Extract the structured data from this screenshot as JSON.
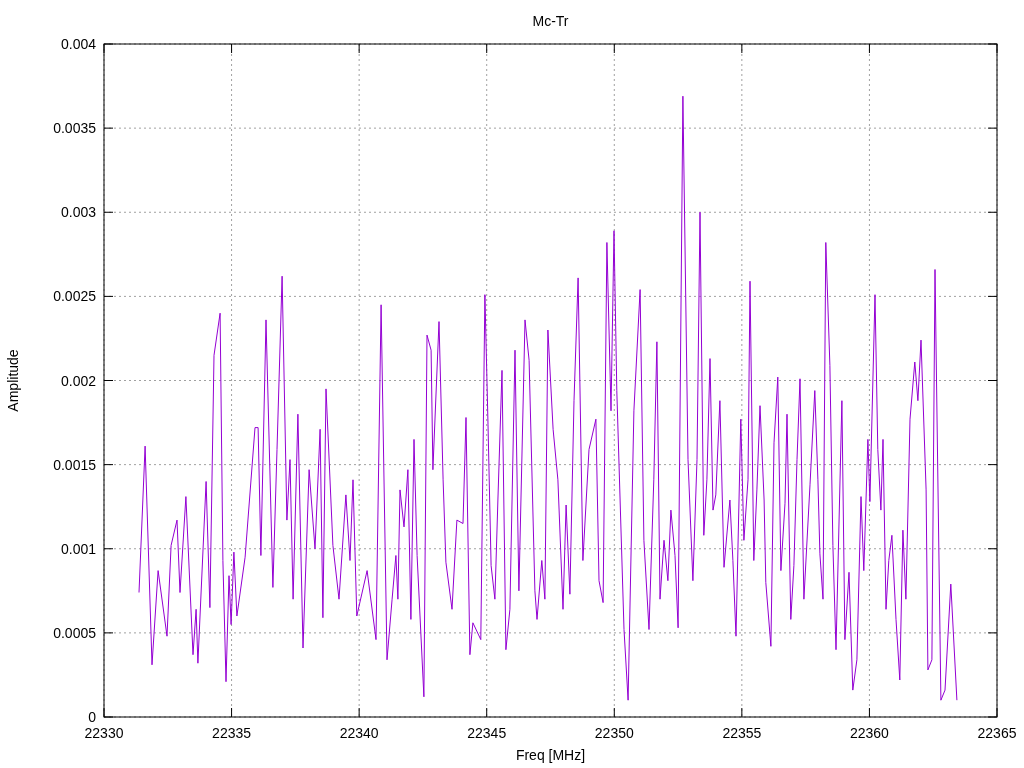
{
  "chart_data": {
    "type": "line",
    "title": "Mc-Tr",
    "xlabel": "Freq [MHz]",
    "ylabel": "Amplitude",
    "xlim": [
      22330,
      22365
    ],
    "ylim": [
      0,
      0.004
    ],
    "xticks": [
      22330,
      22335,
      22340,
      22345,
      22350,
      22355,
      22360,
      22365
    ],
    "yticks": [
      0,
      0.0005,
      0.001,
      0.0015,
      0.002,
      0.0025,
      0.003,
      0.0035,
      0.004
    ],
    "x": [
      22331.37,
      22331.61,
      22331.88,
      22332.12,
      22332.47,
      22332.63,
      22332.86,
      22332.98,
      22333.21,
      22333.49,
      22333.61,
      22333.68,
      22334.0,
      22334.15,
      22334.31,
      22334.55,
      22334.66,
      22334.78,
      22334.9,
      22334.98,
      22335.09,
      22335.21,
      22335.53,
      22335.92,
      22336.04,
      22336.15,
      22336.35,
      22336.62,
      22336.78,
      22336.98,
      22337.17,
      22337.29,
      22337.41,
      22337.6,
      22337.8,
      22338.04,
      22338.27,
      22338.47,
      22338.58,
      22338.7,
      22338.97,
      22339.21,
      22339.48,
      22339.64,
      22339.76,
      22339.91,
      22340.31,
      22340.66,
      22340.86,
      22341.09,
      22341.29,
      22341.44,
      22341.52,
      22341.6,
      22341.76,
      22341.91,
      22342.03,
      22342.15,
      22342.27,
      22342.54,
      22342.66,
      22342.82,
      22342.89,
      22343.13,
      22343.29,
      22343.4,
      22343.64,
      22343.83,
      22344.07,
      22344.19,
      22344.34,
      22344.46,
      22344.77,
      22344.93,
      22345.05,
      22345.17,
      22345.32,
      22345.44,
      22345.6,
      22345.75,
      22345.91,
      22346.11,
      22346.26,
      22346.5,
      22346.66,
      22346.89,
      22346.97,
      22347.16,
      22347.28,
      22347.4,
      22347.6,
      22347.79,
      22347.99,
      22348.11,
      22348.26,
      22348.42,
      22348.58,
      22348.77,
      22349.01,
      22349.28,
      22349.4,
      22349.56,
      22349.71,
      22349.87,
      22349.99,
      22350.1,
      22350.38,
      22350.54,
      22350.77,
      22351.01,
      22351.16,
      22351.36,
      22351.55,
      22351.67,
      22351.79,
      22351.95,
      22352.1,
      22352.22,
      22352.38,
      22352.5,
      22352.69,
      22352.89,
      22353.08,
      22353.24,
      22353.36,
      22353.51,
      22353.63,
      22353.75,
      22353.87,
      22353.98,
      22354.14,
      22354.3,
      22354.53,
      22354.65,
      22354.77,
      22354.96,
      22355.08,
      22355.24,
      22355.32,
      22355.47,
      22355.59,
      22355.71,
      22355.87,
      22355.94,
      22356.14,
      22356.26,
      22356.41,
      22356.53,
      22356.69,
      22356.77,
      22356.92,
      22357.04,
      22357.16,
      22357.28,
      22357.43,
      22357.67,
      22357.86,
      22357.98,
      22358.06,
      22358.18,
      22358.29,
      22358.45,
      22358.57,
      22358.69,
      22358.92,
      22359.04,
      22359.2,
      22359.35,
      22359.51,
      22359.67,
      22359.78,
      22359.94,
      22360.02,
      22360.22,
      22360.33,
      22360.45,
      22360.53,
      22360.65,
      22360.76,
      22360.88,
      22361.04,
      22361.19,
      22361.31,
      22361.43,
      22361.59,
      22361.78,
      22361.9,
      22362.02,
      22362.22,
      22362.29,
      22362.45,
      22362.57,
      22362.8,
      22362.96,
      22363.19,
      22363.43
    ],
    "grid": true,
    "series": [
      {
        "color": "#9400d3",
        "values": [
          0.00074,
          0.00161,
          0.00031,
          0.00087,
          0.00048,
          0.00102,
          0.00117,
          0.00074,
          0.00131,
          0.00037,
          0.00064,
          0.00032,
          0.0014,
          0.00065,
          0.00215,
          0.0024,
          0.00093,
          0.00021,
          0.00084,
          0.00055,
          0.00098,
          0.0006,
          0.00095,
          0.00172,
          0.00172,
          0.00096,
          0.00236,
          0.00077,
          0.00159,
          0.00262,
          0.00117,
          0.00153,
          0.0007,
          0.0018,
          0.00041,
          0.00147,
          0.001,
          0.00171,
          0.00059,
          0.00195,
          0.00102,
          0.0007,
          0.00132,
          0.00093,
          0.00141,
          0.0006,
          0.00087,
          0.00046,
          0.00245,
          0.00034,
          0.0007,
          0.00096,
          0.0007,
          0.00135,
          0.00113,
          0.00147,
          0.00058,
          0.00165,
          0.00096,
          0.00012,
          0.00227,
          0.00218,
          0.00147,
          0.00235,
          0.00141,
          0.00092,
          0.00064,
          0.00117,
          0.00115,
          0.00178,
          0.00037,
          0.00056,
          0.00046,
          0.00251,
          0.00174,
          0.0009,
          0.0007,
          0.00129,
          0.00206,
          0.0004,
          0.00064,
          0.00218,
          0.00075,
          0.00236,
          0.00212,
          0.00075,
          0.00058,
          0.00093,
          0.0007,
          0.0023,
          0.00171,
          0.00141,
          0.00064,
          0.00126,
          0.00073,
          0.00188,
          0.00261,
          0.00093,
          0.00159,
          0.00177,
          0.00081,
          0.00068,
          0.00282,
          0.00182,
          0.00289,
          0.00194,
          0.00052,
          0.0001,
          0.00182,
          0.00254,
          0.00105,
          0.00052,
          0.00141,
          0.00223,
          0.0007,
          0.00105,
          0.00081,
          0.00123,
          0.00096,
          0.00053,
          0.00369,
          0.00153,
          0.00081,
          0.00153,
          0.003,
          0.00108,
          0.00141,
          0.00213,
          0.00123,
          0.00132,
          0.00188,
          0.00089,
          0.00129,
          0.00093,
          0.00048,
          0.00177,
          0.00105,
          0.00141,
          0.00259,
          0.00093,
          0.00135,
          0.00185,
          0.00129,
          0.0008,
          0.00042,
          0.00163,
          0.00202,
          0.00087,
          0.00127,
          0.0018,
          0.00058,
          0.0009,
          0.00153,
          0.00201,
          0.0007,
          0.00138,
          0.00194,
          0.00141,
          0.00097,
          0.0007,
          0.00282,
          0.00209,
          0.00102,
          0.0004,
          0.00188,
          0.00046,
          0.00086,
          0.00016,
          0.00034,
          0.00131,
          0.00087,
          0.00165,
          0.00128,
          0.00251,
          0.00159,
          0.00123,
          0.00165,
          0.00064,
          0.00093,
          0.00108,
          0.00058,
          0.00022,
          0.00111,
          0.0007,
          0.00177,
          0.00211,
          0.00188,
          0.00224,
          0.00135,
          0.00028,
          0.00034,
          0.00266,
          0.0001,
          0.00016,
          0.00079,
          0.0001
        ]
      }
    ]
  }
}
